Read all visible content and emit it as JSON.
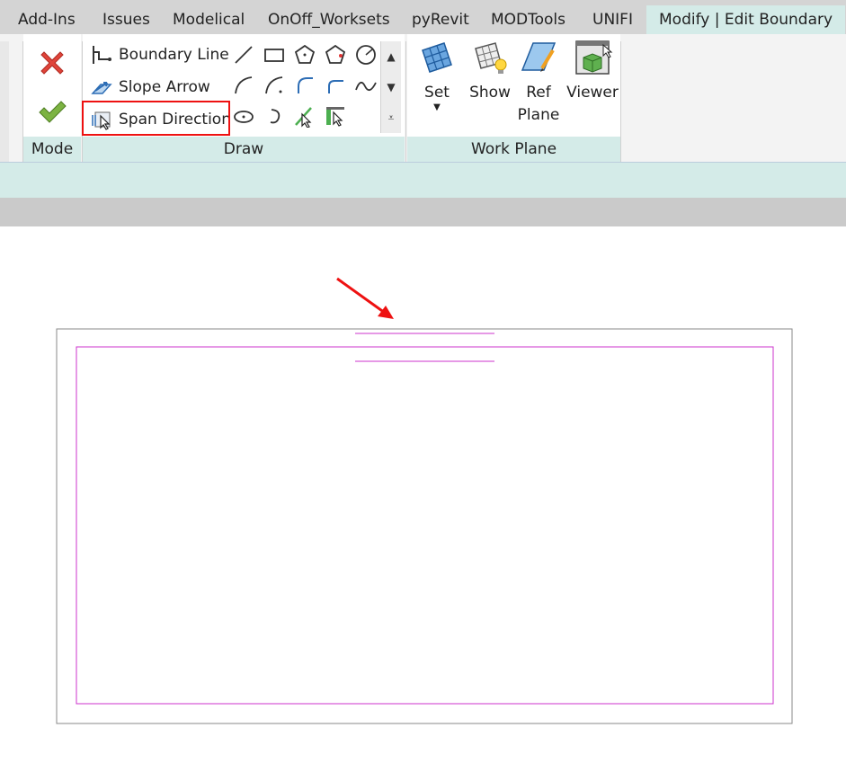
{
  "tabs": [
    {
      "label": "Add-Ins"
    },
    {
      "label": "Issues"
    },
    {
      "label": "Modelical"
    },
    {
      "label": "OnOff_Worksets"
    },
    {
      "label": "pyRevit"
    },
    {
      "label": "MODTools"
    },
    {
      "label": "UNIFI"
    },
    {
      "label": "Modify | Edit Boundary",
      "active": true
    }
  ],
  "mode_panel": {
    "title": "Mode"
  },
  "draw_panel": {
    "title": "Draw",
    "buttons": [
      {
        "label": "Boundary Line",
        "icon": "boundary-line-icon"
      },
      {
        "label": "Slope Arrow",
        "icon": "slope-arrow-icon"
      },
      {
        "label": "Span Direction",
        "icon": "span-direction-icon",
        "highlighted": true
      }
    ]
  },
  "work_plane_panel": {
    "title": "Work Plane",
    "buttons": [
      {
        "label": "Set",
        "icon": "set-workplane-icon"
      },
      {
        "label": "Show",
        "icon": "show-workplane-icon"
      },
      {
        "label_line1": "Ref",
        "label_line2": "Plane",
        "icon": "ref-plane-icon"
      },
      {
        "label": "Viewer",
        "icon": "viewer-icon"
      }
    ]
  },
  "colors": {
    "accent_tab": "#d4ebe8",
    "boundary_line": "#cc33cc",
    "highlight": "#e11111",
    "arrow": "#e11111"
  }
}
